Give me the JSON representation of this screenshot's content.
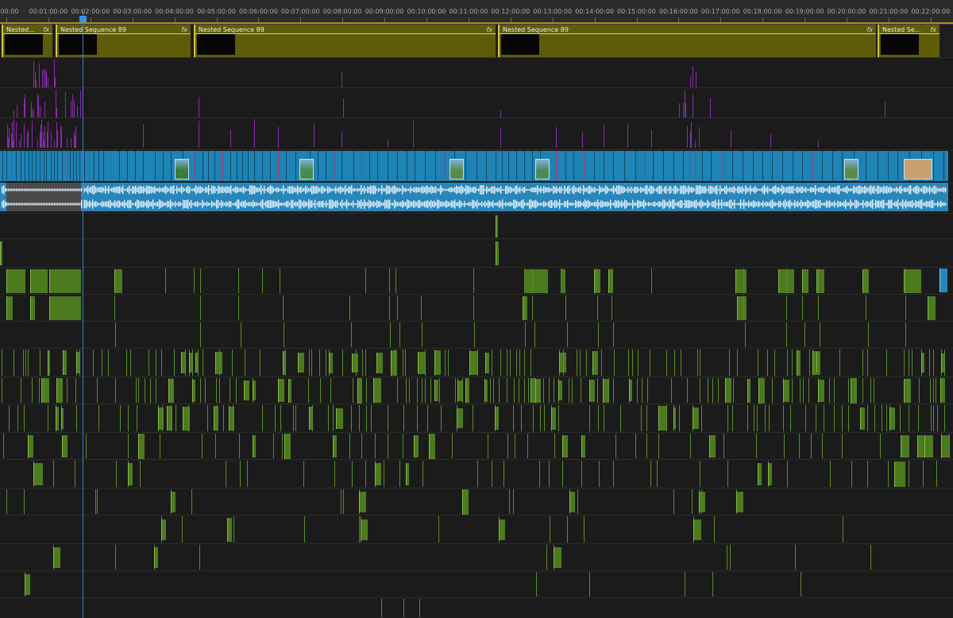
{
  "ruler": {
    "labels": [
      "00:00",
      "00:01:00:00",
      "00:02:00:00",
      "00:03:00:00",
      "00:04:00:00",
      "00:05:00:00",
      "00:06:00:00",
      "00:07:00:00",
      "00:08:00:00",
      "00:09:00:00",
      "00:10:00:00",
      "00:11:00:00",
      "00:12:00:00",
      "00:13:00:00",
      "00:14:00:00",
      "00:15:00:00",
      "00:16:00:00",
      "00:17:00:00",
      "00:18:00:00",
      "00:19:00:00",
      "00:20:00:00",
      "00:21:00:00",
      "00:22:00:00"
    ]
  },
  "nested_track": {
    "clips": [
      {
        "label": "Nested...",
        "fx": "fx"
      },
      {
        "label": "Nested Sequence 89",
        "fx": "fx"
      },
      {
        "label": "Nested Sequence 89",
        "fx": "fx"
      },
      {
        "label": "Nested Sequence 89",
        "fx": "fx"
      },
      {
        "label": "Nested Se...",
        "fx": "fx"
      }
    ]
  },
  "colors": {
    "nested_clip": "#5f5c08",
    "video_clip": "#1e83b5",
    "audio_clip": "#2a86b8",
    "green_clip": "#4c7a1e",
    "playhead": "#3a7fd8",
    "marker_purple": "#8a2ab0"
  },
  "icons": [
    "fx-badge-icon",
    "playhead-icon"
  ]
}
